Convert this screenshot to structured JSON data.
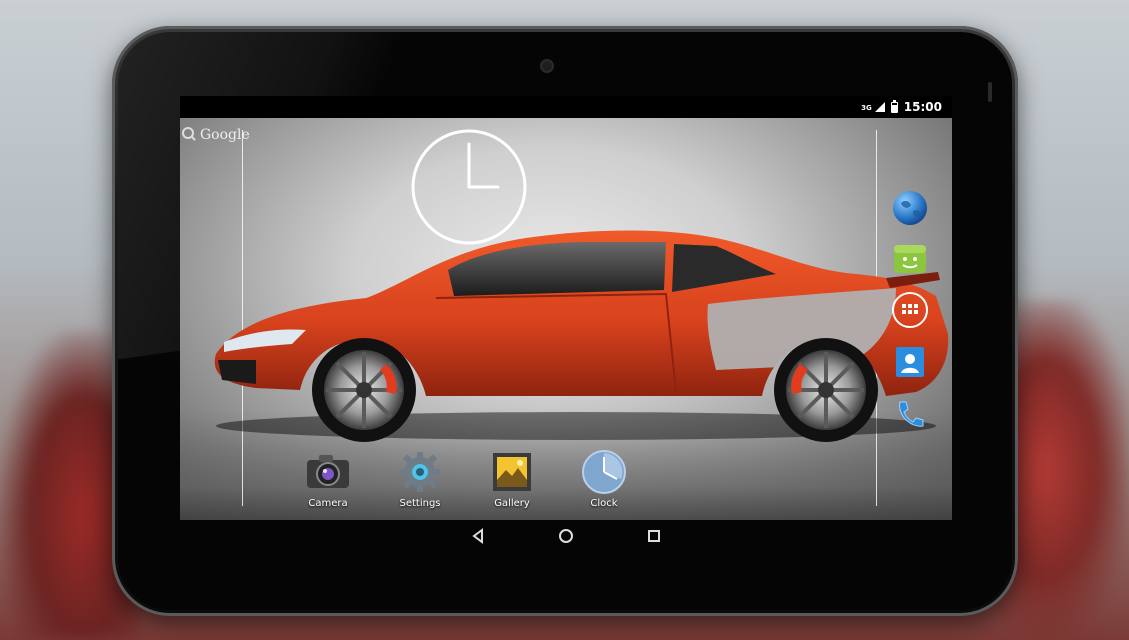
{
  "status_bar": {
    "network": "3G",
    "time": "15:00"
  },
  "search_widget": {
    "label": "Google"
  },
  "clock_widget": {
    "hour_hand_hour": 3,
    "minute_hand_minute": 0
  },
  "hotseat": [
    {
      "label": "Camera",
      "icon": "camera-icon"
    },
    {
      "label": "Settings",
      "icon": "settings-icon"
    },
    {
      "label": "Gallery",
      "icon": "gallery-icon"
    },
    {
      "label": "Clock",
      "icon": "clock-app-icon"
    }
  ],
  "side_dock": [
    {
      "icon": "browser-globe-icon"
    },
    {
      "icon": "android-market-icon"
    },
    {
      "icon": "app-drawer-icon"
    },
    {
      "icon": "contacts-icon"
    },
    {
      "icon": "phone-icon"
    }
  ],
  "navigation": {
    "back": "back-icon",
    "home": "home-icon",
    "recents": "recents-icon"
  },
  "colors": {
    "car_red": "#d8421d",
    "icon_blue": "#2a78c8",
    "android_green": "#8cc63f"
  }
}
